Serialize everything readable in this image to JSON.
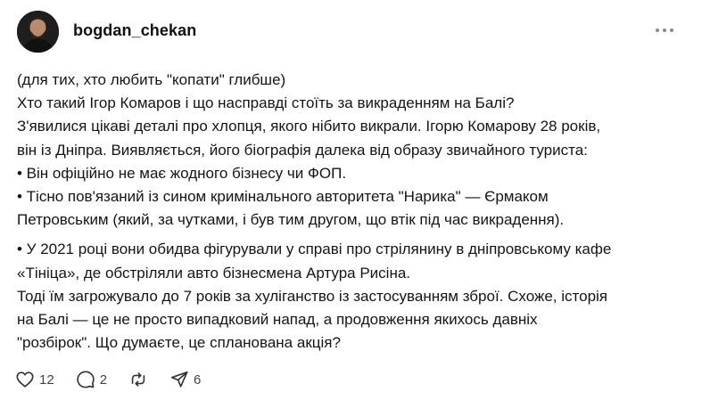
{
  "post": {
    "username": "bogdan_chekan",
    "lines": [
      "(для тих, хто любить \"копати\" глибше)",
      "Хто такий Ігор Комаров і що насправді стоїть за викраденням на Балі?",
      "З'явилися цікаві деталі про хлопця, якого нібито викрали. Ігорю Комарову 28 років,",
      "він із Дніпра. Виявляється, його біографія далека від образу звичайного туриста:",
      "• Він офіційно не має жодного бізнесу чи ФОП.",
      "• Тісно пов'язаний із сином кримінального авторитета \"Нарика\" — Єрмаком",
      "Петровським (який, за чутками, і був тим другом, що втік під час викрадення)."
    ],
    "lines2": [
      "• У 2021 році вони обидва фігурували у справі про стрілянину в дніпровському кафе",
      "«Тініца», де обстріляли авто бізнесмена Артура Рисіна.",
      "Тоді їм загрожувало до 7 років за хуліганство із застосуванням зброї. Схоже, історія",
      "на Балі — це не просто випадковий напад, а продовження якихось давніх",
      "\"розбірок\". Що думаєте, це спланована акція?"
    ]
  },
  "actions": {
    "likes": "12",
    "comments": "2",
    "shares": "6"
  },
  "icons": {
    "more": "more-horizontal-icon",
    "like": "heart-icon",
    "comment": "comment-bubble-icon",
    "repost": "repost-icon",
    "share": "send-icon"
  },
  "colors": {
    "text": "#151515",
    "icon": "#333333",
    "muted": "#8a8a8a"
  }
}
